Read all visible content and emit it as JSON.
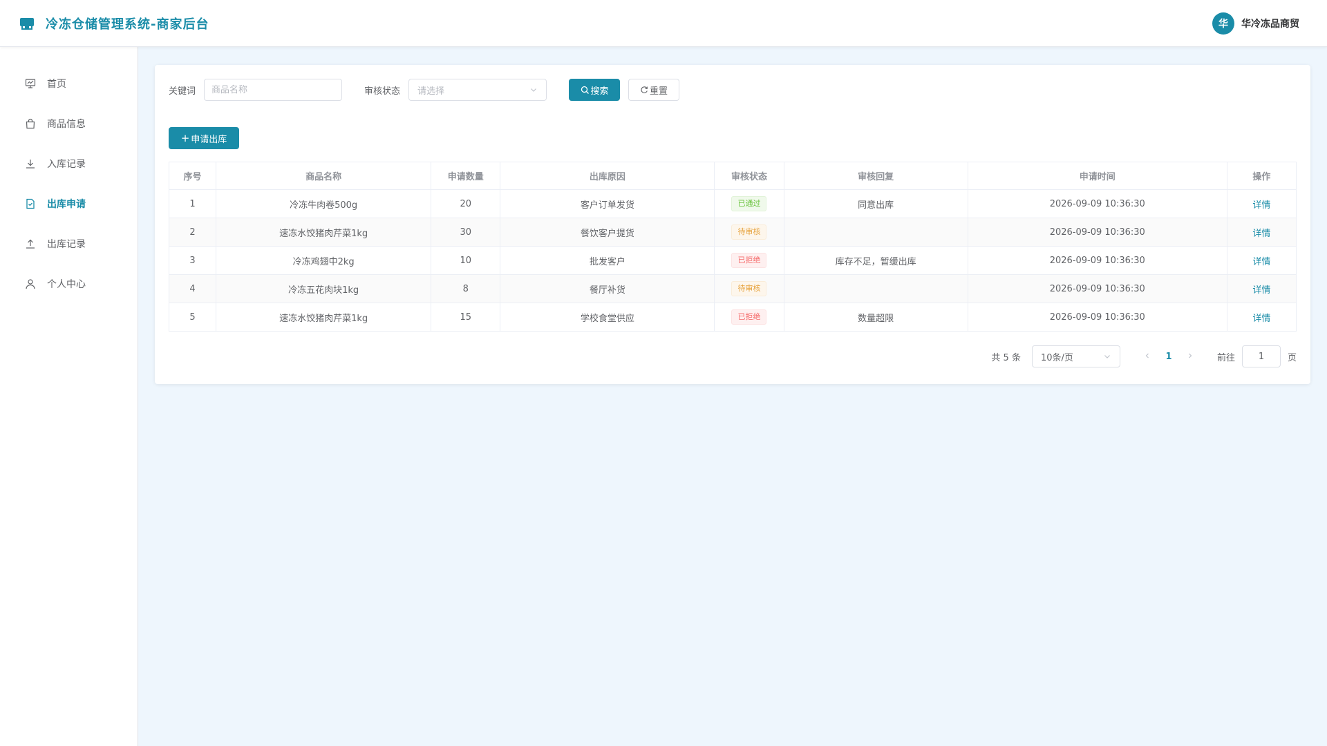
{
  "header": {
    "title": "冷冻仓储管理系统-商家后台",
    "avatar_char": "华",
    "user_name": "华冷冻品商贸",
    "accent_color": "#1a8ca8"
  },
  "sidebar": {
    "items": [
      {
        "label": "首页",
        "icon": "dashboard-icon",
        "active": false
      },
      {
        "label": "商品信息",
        "icon": "shopping-bag-icon",
        "active": false
      },
      {
        "label": "入库记录",
        "icon": "download-icon",
        "active": false
      },
      {
        "label": "出库申请",
        "icon": "document-check-icon",
        "active": true
      },
      {
        "label": "出库记录",
        "icon": "upload-icon",
        "active": false
      },
      {
        "label": "个人中心",
        "icon": "user-icon",
        "active": false
      }
    ]
  },
  "filters": {
    "keyword_label": "关键词",
    "keyword_placeholder": "商品名称",
    "status_label": "审核状态",
    "status_placeholder": "请选择",
    "search_label": "搜索",
    "reset_label": "重置"
  },
  "toolbar": {
    "add_label": "申请出库"
  },
  "table": {
    "headers": [
      "序号",
      "商品名称",
      "申请数量",
      "出库原因",
      "审核状态",
      "审核回复",
      "申请时间",
      "操作"
    ],
    "rows": [
      {
        "index": "1",
        "name": "冷冻牛肉卷500g",
        "qty": "20",
        "reason": "客户订单发货",
        "status": "已通过",
        "status_type": "success",
        "reply": "同意出库",
        "time": "2026-09-09 10:36:30",
        "action": "详情"
      },
      {
        "index": "2",
        "name": "速冻水饺猪肉芹菜1kg",
        "qty": "30",
        "reason": "餐饮客户提货",
        "status": "待审核",
        "status_type": "warning",
        "reply": "",
        "time": "2026-09-09 10:36:30",
        "action": "详情"
      },
      {
        "index": "3",
        "name": "冷冻鸡翅中2kg",
        "qty": "10",
        "reason": "批发客户",
        "status": "已拒绝",
        "status_type": "danger",
        "reply": "库存不足，暂缓出库",
        "time": "2026-09-09 10:36:30",
        "action": "详情"
      },
      {
        "index": "4",
        "name": "冷冻五花肉块1kg",
        "qty": "8",
        "reason": "餐厅补货",
        "status": "待审核",
        "status_type": "warning",
        "reply": "",
        "time": "2026-09-09 10:36:30",
        "action": "详情"
      },
      {
        "index": "5",
        "name": "速冻水饺猪肉芹菜1kg",
        "qty": "15",
        "reason": "学校食堂供应",
        "status": "已拒绝",
        "status_type": "danger",
        "reply": "数量超限",
        "time": "2026-09-09 10:36:30",
        "action": "详情"
      }
    ]
  },
  "pagination": {
    "total_text": "共 5 条",
    "page_size": "10条/页",
    "current_page": "1",
    "goto_label": "前往",
    "goto_value": "1",
    "goto_suffix": "页"
  }
}
